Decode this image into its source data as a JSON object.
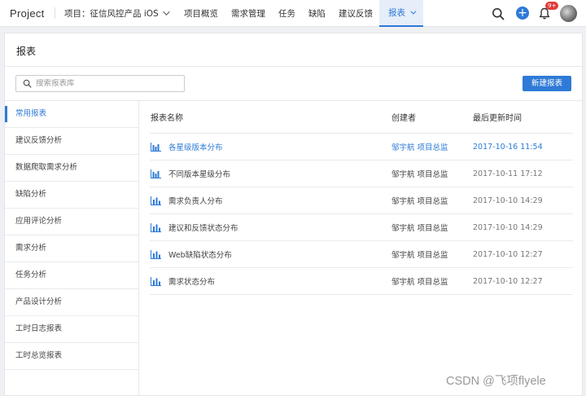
{
  "topbar": {
    "brand": "Project",
    "project_label": "项目：征信风控产品 iOS",
    "nav": [
      "项目概览",
      "需求管理",
      "任务",
      "缺陷",
      "建议反馈"
    ],
    "active_nav": "报表",
    "badge": "9+"
  },
  "colors": {
    "accent": "#2e7ad6",
    "badge": "#e03b3b"
  },
  "panel": {
    "title": "报表",
    "search_placeholder": "搜索报表库",
    "new_button": "新建报表"
  },
  "sidebar": {
    "items": [
      {
        "label": "常用报表",
        "active": true
      },
      {
        "label": "建议反馈分析"
      },
      {
        "label": "数据爬取需求分析"
      },
      {
        "label": "缺陷分析"
      },
      {
        "label": "应用评论分析"
      },
      {
        "label": "需求分析"
      },
      {
        "label": "任务分析"
      },
      {
        "label": "产品设计分析"
      },
      {
        "label": "工时日志报表"
      },
      {
        "label": "工时总览报表"
      }
    ]
  },
  "table": {
    "headers": {
      "name": "报表名称",
      "creator": "创建者",
      "time": "最后更新时间"
    },
    "rows": [
      {
        "name": "各星级版本分布",
        "creator": "邹宇航  项目总监",
        "time": "2017-10-16 11:54",
        "highlighted": true,
        "icon": "grouped-bar-chart-icon"
      },
      {
        "name": "不同版本星级分布",
        "creator": "邹宇航  项目总监",
        "time": "2017-10-11 17:12",
        "icon": "grouped-bar-chart-icon"
      },
      {
        "name": "需求负责人分布",
        "creator": "邹宇航  项目总监",
        "time": "2017-10-10 14:29",
        "icon": "bar-chart-icon"
      },
      {
        "name": "建议和反馈状态分布",
        "creator": "邹宇航  项目总监",
        "time": "2017-10-10 14:29",
        "icon": "bar-chart-icon"
      },
      {
        "name": "Web缺陷状态分布",
        "creator": "邹宇航  项目总监",
        "time": "2017-10-10 12:27",
        "icon": "bar-chart-icon"
      },
      {
        "name": "需求状态分布",
        "creator": "邹宇航  项目总监",
        "time": "2017-10-10 12:27",
        "icon": "bar-chart-icon"
      }
    ]
  },
  "watermark": "CSDN @飞项flyele"
}
